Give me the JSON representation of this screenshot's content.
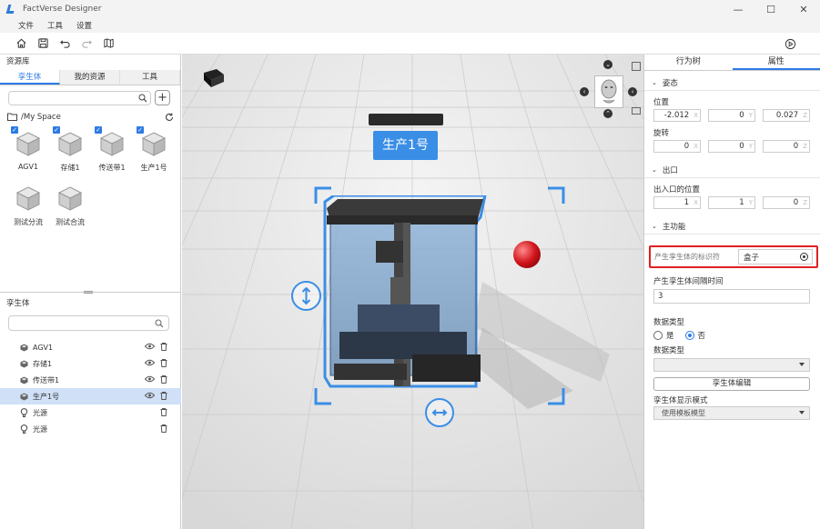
{
  "window": {
    "title": "FactVerse Designer"
  },
  "menu": [
    "文件",
    "工具",
    "设置"
  ],
  "left": {
    "panel_title": "资源库",
    "tabs": [
      "孪生体",
      "我的资源",
      "工具"
    ],
    "path": "/My Space",
    "assets": [
      {
        "label": "AGV1",
        "checked": true
      },
      {
        "label": "存储1",
        "checked": true
      },
      {
        "label": "传送带1",
        "checked": true
      },
      {
        "label": "生产1号",
        "checked": true
      },
      {
        "label": "测试分流",
        "checked": false
      },
      {
        "label": "测试合流",
        "checked": false
      }
    ],
    "twin_title": "孪生体",
    "twins": [
      {
        "label": "AGV1",
        "icon": "cube-icon",
        "visible": true,
        "selected": false
      },
      {
        "label": "存储1",
        "icon": "cube-icon",
        "visible": true,
        "selected": false
      },
      {
        "label": "传送带1",
        "icon": "cube-icon",
        "visible": true,
        "selected": false
      },
      {
        "label": "生产1号",
        "icon": "cube-icon",
        "visible": true,
        "selected": true
      },
      {
        "label": "光源",
        "icon": "lightbulb-icon",
        "visible": false,
        "selected": false
      },
      {
        "label": "光源",
        "icon": "lightbulb-icon",
        "visible": false,
        "selected": false
      }
    ]
  },
  "viewport": {
    "object_label": "生产1号"
  },
  "right": {
    "tabs": [
      "行为树",
      "属性"
    ],
    "pose": {
      "title": "姿态",
      "position_label": "位置",
      "position": [
        "-2.012",
        "0",
        "0.027"
      ],
      "rotation_label": "旋转",
      "rotation": [
        "0",
        "0",
        "0"
      ]
    },
    "exit": {
      "title": "出口",
      "io_label": "出入口的位置",
      "io": [
        "1",
        "1",
        "0"
      ]
    },
    "main": {
      "title": "主功能",
      "id_label": "产生孪生体的标识符",
      "id_value": "盒子",
      "interval_label": "产生孪生体间隔时间",
      "interval_value": "3",
      "dtype_label": "数据类型",
      "yes": "是",
      "no": "否",
      "dtype2_label": "数据类型",
      "dtype2_value": "",
      "edit_button": "孪生体编辑",
      "display_mode_label": "孪生体显示模式",
      "display_mode_value": "使用模板模型"
    }
  },
  "colors": {
    "accent": "#2d7be5",
    "highlight": "#e02020"
  }
}
